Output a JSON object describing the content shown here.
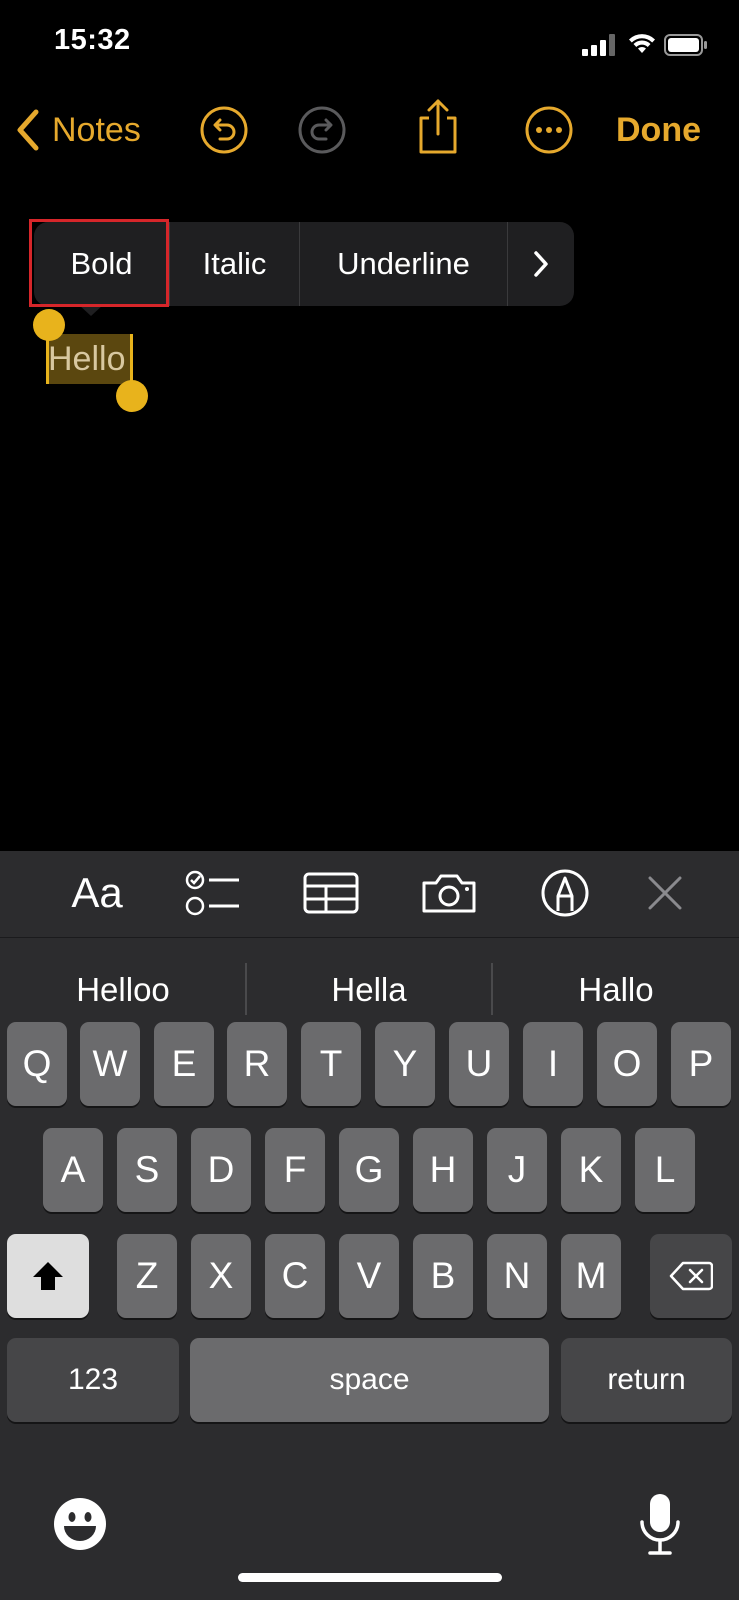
{
  "status_bar": {
    "time": "15:32"
  },
  "nav": {
    "back_label": "Notes",
    "done_label": "Done"
  },
  "format_menu": {
    "items": [
      "Bold",
      "Italic",
      "Underline"
    ],
    "more_icon": "chevron-right-icon"
  },
  "note": {
    "selected_text": "Hello"
  },
  "toolbar": {
    "format_label": "Aa",
    "icons": [
      "checklist-icon",
      "table-icon",
      "camera-icon",
      "markup-icon",
      "close-icon"
    ]
  },
  "suggestions": [
    "Helloo",
    "Hella",
    "Hallo"
  ],
  "keyboard": {
    "row1": [
      "Q",
      "W",
      "E",
      "R",
      "T",
      "Y",
      "U",
      "I",
      "O",
      "P"
    ],
    "row2": [
      "A",
      "S",
      "D",
      "F",
      "G",
      "H",
      "J",
      "K",
      "L"
    ],
    "row3": [
      "Z",
      "X",
      "C",
      "V",
      "B",
      "N",
      "M"
    ],
    "numbers_label": "123",
    "space_label": "space",
    "return_label": "return"
  },
  "colors": {
    "accent": "#e6a92d",
    "selection": "#5b470f",
    "highlight_box": "#d6262a"
  }
}
